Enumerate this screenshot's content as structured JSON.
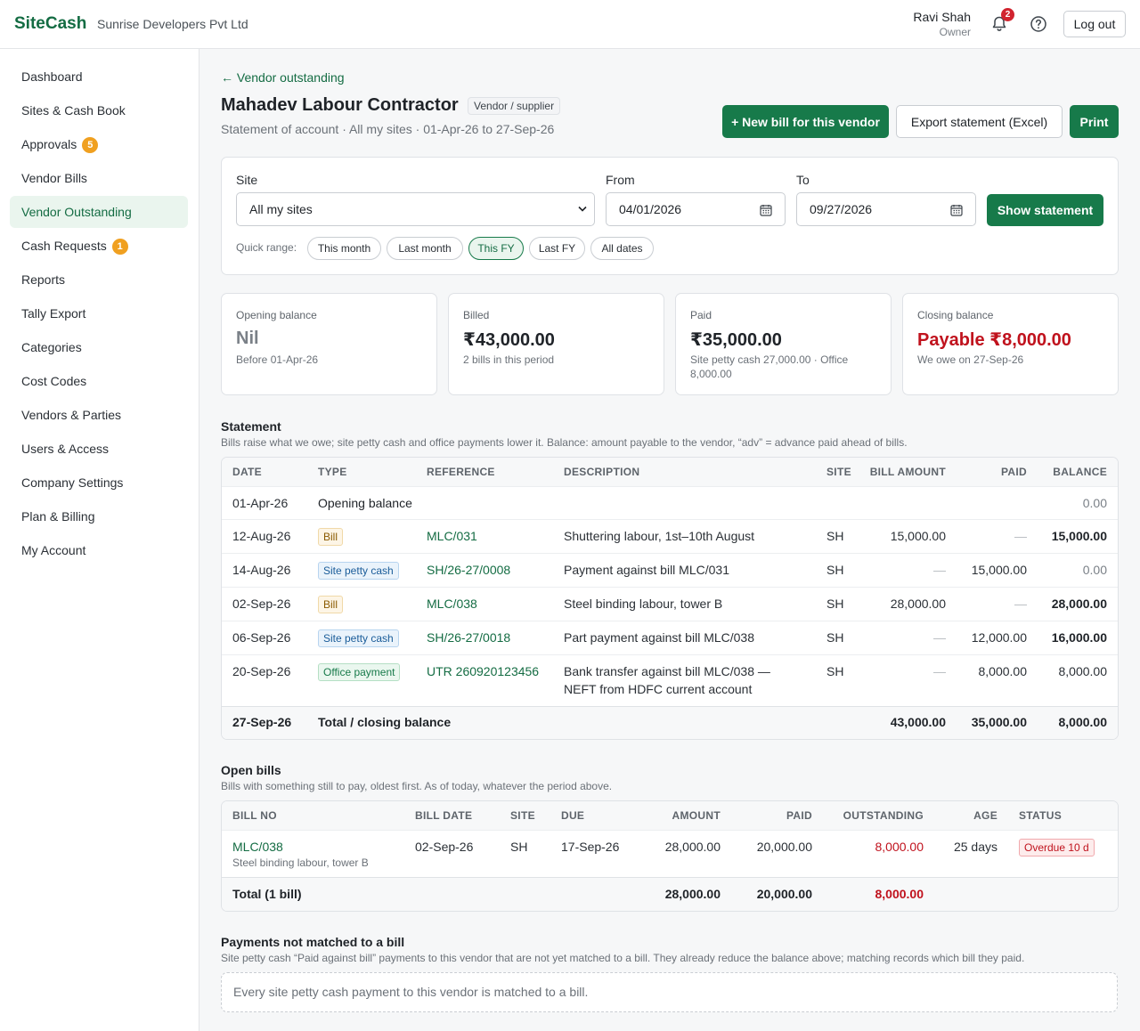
{
  "header": {
    "brand": "SiteCash",
    "company": "Sunrise Developers Pvt Ltd",
    "user_name": "Ravi Shah",
    "user_role": "Owner",
    "notification_count": "2",
    "logout_label": "Log out"
  },
  "sidebar": {
    "items": [
      {
        "label": "Dashboard"
      },
      {
        "label": "Sites & Cash Book"
      },
      {
        "label": "Approvals",
        "badge": "5"
      },
      {
        "label": "Vendor Bills"
      },
      {
        "label": "Vendor Outstanding",
        "active": true
      },
      {
        "label": "Cash Requests",
        "badge": "1"
      },
      {
        "label": "Reports"
      },
      {
        "label": "Tally Export"
      },
      {
        "label": "Categories"
      },
      {
        "label": "Cost Codes"
      },
      {
        "label": "Vendors & Parties"
      },
      {
        "label": "Users & Access"
      },
      {
        "label": "Company Settings"
      },
      {
        "label": "Plan & Billing"
      },
      {
        "label": "My Account"
      }
    ]
  },
  "page": {
    "back_link": "← Vendor outstanding",
    "vendor_name": "Mahadev Labour Contractor",
    "vendor_tag": "Vendor / supplier",
    "subtitle": "Statement of account · All my sites · 01-Apr-26 to 27-Sep-26",
    "new_bill_label": "+ New bill for this vendor",
    "export_label": "Export statement (Excel)",
    "print_label": "Print"
  },
  "filters": {
    "site_label": "Site",
    "site_value": "All my sites",
    "from_label": "From",
    "from_value": "04/01/2026",
    "to_label": "To",
    "to_value": "09/27/2026",
    "show_label": "Show statement",
    "quick_label": "Quick range:",
    "chips": [
      "This month",
      "Last month",
      "This FY",
      "Last FY",
      "All dates"
    ],
    "active_chip": "This FY"
  },
  "summary": {
    "opening": {
      "label": "Opening balance",
      "value": "Nil",
      "note": "Before 01-Apr-26"
    },
    "billed": {
      "label": "Billed",
      "value": "₹43,000.00",
      "note": "2 bills in this period"
    },
    "paid": {
      "label": "Paid",
      "value": "₹35,000.00",
      "note": "Site petty cash 27,000.00 · Office 8,000.00"
    },
    "closing": {
      "label": "Closing balance",
      "value": "Payable ₹8,000.00",
      "note": "We owe on 27-Sep-26"
    }
  },
  "statement": {
    "title": "Statement",
    "subtitle": "Bills raise what we owe; site petty cash and office payments lower it. Balance: amount payable to the vendor, “adv” = advance paid ahead of bills.",
    "headers": [
      "DATE",
      "TYPE",
      "REFERENCE",
      "DESCRIPTION",
      "SITE",
      "BILL AMOUNT",
      "PAID",
      "BALANCE"
    ],
    "opening_row": {
      "date": "01-Apr-26",
      "type": "Opening balance",
      "balance": "0.00"
    },
    "rows": [
      {
        "date": "12-Aug-26",
        "type": "Bill",
        "ref": "MLC/031",
        "desc": "Shuttering labour, 1st–10th August",
        "desc2": "",
        "site": "SH",
        "bill": "15,000.00",
        "paid": "—",
        "balance": "15,000.00"
      },
      {
        "date": "14-Aug-26",
        "type": "Site petty cash",
        "ref": "SH/26-27/0008",
        "desc": "Payment against bill MLC/031",
        "desc2": "",
        "site": "SH",
        "bill": "—",
        "paid": "15,000.00",
        "balance": "0.00"
      },
      {
        "date": "02-Sep-26",
        "type": "Bill",
        "ref": "MLC/038",
        "desc": "Steel binding labour, tower B",
        "desc2": "",
        "site": "SH",
        "bill": "28,000.00",
        "paid": "—",
        "balance": "28,000.00"
      },
      {
        "date": "06-Sep-26",
        "type": "Site petty cash",
        "ref": "SH/26-27/0018",
        "desc": "Part payment against bill MLC/038",
        "desc2": "",
        "site": "SH",
        "bill": "—",
        "paid": "12,000.00",
        "balance": "16,000.00"
      },
      {
        "date": "20-Sep-26",
        "type": "Office payment",
        "ref": "UTR 260920123456",
        "desc": "Bank transfer against bill MLC/038 —",
        "desc2": "NEFT from HDFC current account",
        "site": "SH",
        "bill": "—",
        "paid": "8,000.00",
        "balance": "8,000.00"
      }
    ],
    "total_row": {
      "date": "27-Sep-26",
      "label": "Total / closing balance",
      "bill": "43,000.00",
      "paid": "35,000.00",
      "balance": "8,000.00"
    }
  },
  "open_bills": {
    "title": "Open bills",
    "subtitle": "Bills with something still to pay, oldest first. As of today, whatever the period above.",
    "headers": [
      "BILL NO",
      "BILL DATE",
      "SITE",
      "DUE",
      "AMOUNT",
      "PAID",
      "OUTSTANDING",
      "AGE",
      "STATUS"
    ],
    "rows": [
      {
        "bill_no": "MLC/038",
        "desc": "Steel binding labour, tower B",
        "date": "02-Sep-26",
        "site": "SH",
        "due": "17-Sep-26",
        "amount": "28,000.00",
        "paid": "20,000.00",
        "outstanding": "8,000.00",
        "age": "25 days",
        "status": "Overdue 10 d"
      }
    ],
    "total": {
      "label": "Total (1 bill)",
      "amount": "28,000.00",
      "paid": "20,000.00",
      "outstanding": "8,000.00"
    }
  },
  "unmatched": {
    "title": "Payments not matched to a bill",
    "subtitle": "Site petty cash “Paid against bill” payments to this vendor that are not yet matched to a bill. They already reduce the balance above; matching records which bill they paid.",
    "empty": "Every site petty cash payment to this vendor is matched to a bill."
  },
  "colors": {
    "brand": "#146c43",
    "accent": "#177a4a",
    "danger": "#c0121d",
    "badge": "#f0a020"
  }
}
